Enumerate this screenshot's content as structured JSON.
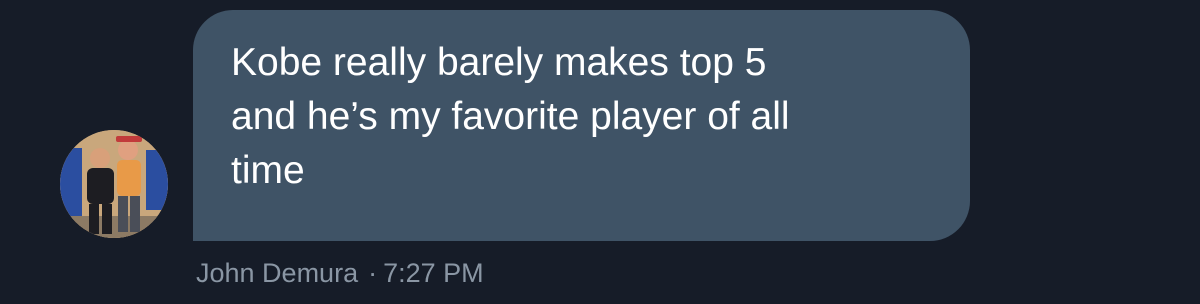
{
  "message": {
    "text": "Kobe really barely makes top 5\nand he’s my favorite player of all\ntime",
    "sender": "John Demura",
    "separator": "·",
    "time": "7:27 PM"
  },
  "colors": {
    "background": "#161c28",
    "bubble": "#3f5366",
    "message_text": "#ffffff",
    "meta_text": "#8a96a4"
  },
  "icons": {
    "avatar": "profile-photo-avatar"
  }
}
